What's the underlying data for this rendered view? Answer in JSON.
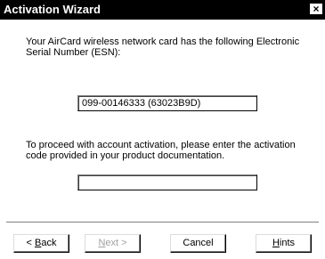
{
  "window": {
    "title": "Activation Wizard",
    "close_glyph": "×"
  },
  "content": {
    "esn_message": "Your AirCard wireless network card has the following Electronic Serial Number (ESN):",
    "esn_value": "099-00146333 (63023B9D)",
    "activation_message": "To proceed with account activation, please enter the activation code provided in your product documentation.",
    "activation_code_value": ""
  },
  "buttons": {
    "back_prefix": "< ",
    "back_mnemonic": "B",
    "back_rest": "ack",
    "next_mnemonic": "N",
    "next_rest": "ext >",
    "cancel": "Cancel",
    "hints_mnemonic": "H",
    "hints_rest": "ints"
  },
  "state": {
    "next_enabled": false
  }
}
